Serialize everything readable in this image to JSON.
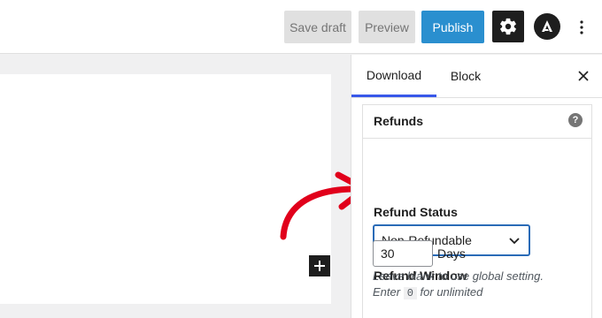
{
  "header": {
    "save_draft": "Save draft",
    "preview": "Preview",
    "publish": "Publish",
    "settings_icon": "gear-icon",
    "astra_icon": "astra-logo-icon",
    "more_icon": "vertical-ellipsis-icon"
  },
  "editor": {
    "add_block_icon": "plus-icon"
  },
  "sidebar": {
    "tabs": [
      {
        "label": "Download",
        "active": true
      },
      {
        "label": "Block",
        "active": false
      }
    ],
    "close_icon": "close-icon",
    "panel": {
      "title": "Refunds",
      "help_icon": "?",
      "refund_status": {
        "label": "Refund Status",
        "value": "Non-Refundable"
      },
      "refund_window": {
        "label": "Refund Window",
        "value": "30",
        "unit": "Days",
        "hint_line1": "Leave blank to use global setting.",
        "hint_enter": "Enter",
        "hint_code": "0",
        "hint_suffix": "for unlimited"
      }
    }
  },
  "colors": {
    "accent": "#2a8fcf",
    "arrow": "#e1001b",
    "tab_indicator": "#3858e9"
  }
}
